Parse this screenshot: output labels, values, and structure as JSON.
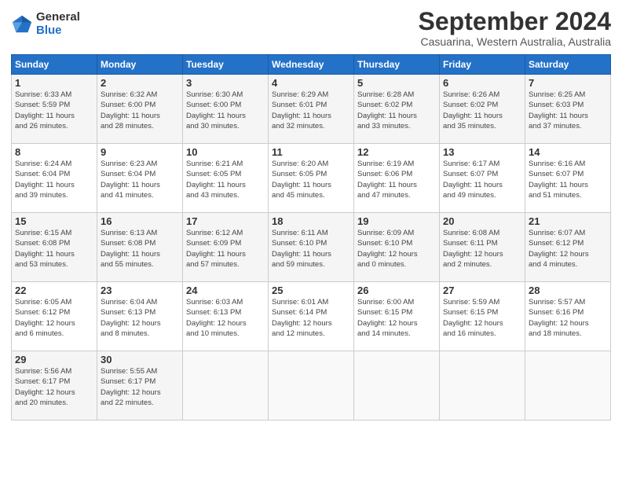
{
  "logo": {
    "general": "General",
    "blue": "Blue"
  },
  "title": "September 2024",
  "location": "Casuarina, Western Australia, Australia",
  "headers": [
    "Sunday",
    "Monday",
    "Tuesday",
    "Wednesday",
    "Thursday",
    "Friday",
    "Saturday"
  ],
  "weeks": [
    [
      {
        "day": "1",
        "info": "Sunrise: 6:33 AM\nSunset: 5:59 PM\nDaylight: 11 hours\nand 26 minutes."
      },
      {
        "day": "2",
        "info": "Sunrise: 6:32 AM\nSunset: 6:00 PM\nDaylight: 11 hours\nand 28 minutes."
      },
      {
        "day": "3",
        "info": "Sunrise: 6:30 AM\nSunset: 6:00 PM\nDaylight: 11 hours\nand 30 minutes."
      },
      {
        "day": "4",
        "info": "Sunrise: 6:29 AM\nSunset: 6:01 PM\nDaylight: 11 hours\nand 32 minutes."
      },
      {
        "day": "5",
        "info": "Sunrise: 6:28 AM\nSunset: 6:02 PM\nDaylight: 11 hours\nand 33 minutes."
      },
      {
        "day": "6",
        "info": "Sunrise: 6:26 AM\nSunset: 6:02 PM\nDaylight: 11 hours\nand 35 minutes."
      },
      {
        "day": "7",
        "info": "Sunrise: 6:25 AM\nSunset: 6:03 PM\nDaylight: 11 hours\nand 37 minutes."
      }
    ],
    [
      {
        "day": "8",
        "info": "Sunrise: 6:24 AM\nSunset: 6:04 PM\nDaylight: 11 hours\nand 39 minutes."
      },
      {
        "day": "9",
        "info": "Sunrise: 6:23 AM\nSunset: 6:04 PM\nDaylight: 11 hours\nand 41 minutes."
      },
      {
        "day": "10",
        "info": "Sunrise: 6:21 AM\nSunset: 6:05 PM\nDaylight: 11 hours\nand 43 minutes."
      },
      {
        "day": "11",
        "info": "Sunrise: 6:20 AM\nSunset: 6:05 PM\nDaylight: 11 hours\nand 45 minutes."
      },
      {
        "day": "12",
        "info": "Sunrise: 6:19 AM\nSunset: 6:06 PM\nDaylight: 11 hours\nand 47 minutes."
      },
      {
        "day": "13",
        "info": "Sunrise: 6:17 AM\nSunset: 6:07 PM\nDaylight: 11 hours\nand 49 minutes."
      },
      {
        "day": "14",
        "info": "Sunrise: 6:16 AM\nSunset: 6:07 PM\nDaylight: 11 hours\nand 51 minutes."
      }
    ],
    [
      {
        "day": "15",
        "info": "Sunrise: 6:15 AM\nSunset: 6:08 PM\nDaylight: 11 hours\nand 53 minutes."
      },
      {
        "day": "16",
        "info": "Sunrise: 6:13 AM\nSunset: 6:08 PM\nDaylight: 11 hours\nand 55 minutes."
      },
      {
        "day": "17",
        "info": "Sunrise: 6:12 AM\nSunset: 6:09 PM\nDaylight: 11 hours\nand 57 minutes."
      },
      {
        "day": "18",
        "info": "Sunrise: 6:11 AM\nSunset: 6:10 PM\nDaylight: 11 hours\nand 59 minutes."
      },
      {
        "day": "19",
        "info": "Sunrise: 6:09 AM\nSunset: 6:10 PM\nDaylight: 12 hours\nand 0 minutes."
      },
      {
        "day": "20",
        "info": "Sunrise: 6:08 AM\nSunset: 6:11 PM\nDaylight: 12 hours\nand 2 minutes."
      },
      {
        "day": "21",
        "info": "Sunrise: 6:07 AM\nSunset: 6:12 PM\nDaylight: 12 hours\nand 4 minutes."
      }
    ],
    [
      {
        "day": "22",
        "info": "Sunrise: 6:05 AM\nSunset: 6:12 PM\nDaylight: 12 hours\nand 6 minutes."
      },
      {
        "day": "23",
        "info": "Sunrise: 6:04 AM\nSunset: 6:13 PM\nDaylight: 12 hours\nand 8 minutes."
      },
      {
        "day": "24",
        "info": "Sunrise: 6:03 AM\nSunset: 6:13 PM\nDaylight: 12 hours\nand 10 minutes."
      },
      {
        "day": "25",
        "info": "Sunrise: 6:01 AM\nSunset: 6:14 PM\nDaylight: 12 hours\nand 12 minutes."
      },
      {
        "day": "26",
        "info": "Sunrise: 6:00 AM\nSunset: 6:15 PM\nDaylight: 12 hours\nand 14 minutes."
      },
      {
        "day": "27",
        "info": "Sunrise: 5:59 AM\nSunset: 6:15 PM\nDaylight: 12 hours\nand 16 minutes."
      },
      {
        "day": "28",
        "info": "Sunrise: 5:57 AM\nSunset: 6:16 PM\nDaylight: 12 hours\nand 18 minutes."
      }
    ],
    [
      {
        "day": "29",
        "info": "Sunrise: 5:56 AM\nSunset: 6:17 PM\nDaylight: 12 hours\nand 20 minutes."
      },
      {
        "day": "30",
        "info": "Sunrise: 5:55 AM\nSunset: 6:17 PM\nDaylight: 12 hours\nand 22 minutes."
      },
      {
        "day": "",
        "info": ""
      },
      {
        "day": "",
        "info": ""
      },
      {
        "day": "",
        "info": ""
      },
      {
        "day": "",
        "info": ""
      },
      {
        "day": "",
        "info": ""
      }
    ]
  ]
}
